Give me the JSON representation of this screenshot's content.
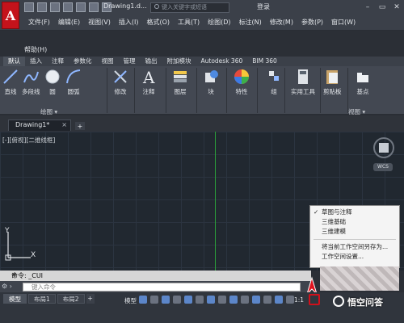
{
  "titlebar": {
    "doc_title": "Drawing1.d...",
    "search_placeholder": "键入关键字或短语",
    "login_label": "登录"
  },
  "menu": {
    "items": [
      "文件(F)",
      "编辑(E)",
      "视图(V)",
      "插入(I)",
      "格式(O)",
      "工具(T)",
      "绘图(D)",
      "标注(N)",
      "修改(M)",
      "参数(P)",
      "窗口(W)"
    ],
    "help": "帮助(H)"
  },
  "ribbon_tabs": [
    "默认",
    "插入",
    "注释",
    "参数化",
    "视图",
    "管理",
    "输出",
    "附加模块",
    "Autodesk 360",
    "BIM 360"
  ],
  "ribbon": {
    "tools": [
      "直线",
      "多段线",
      "圆",
      "圆弧",
      "修改",
      "注释",
      "图层",
      "块",
      "特性",
      "组",
      "实用工具",
      "剪贴板",
      "基点"
    ],
    "panel_draw": "绘图 ▾",
    "panel_view": "视图 ▾"
  },
  "doc_tab": {
    "label": "Drawing1*",
    "close": "×",
    "add": "+"
  },
  "canvas": {
    "viewport_label": "[-][俯视][二维线框]",
    "wcs": "WCS",
    "ucs_y": "Y",
    "ucs_x": "X"
  },
  "context_menu": {
    "items": [
      {
        "label": "草图与注释",
        "checked": true
      },
      {
        "label": "三维基础",
        "checked": false
      },
      {
        "label": "三维建模",
        "checked": false
      }
    ],
    "actions": [
      "将当前工作空间另存为...",
      "工作空间设置..."
    ],
    "check_glyph": "✓"
  },
  "command": {
    "history": "命令: _CUI",
    "input_placeholder": "键入命令",
    "close_glyph": "✕"
  },
  "status": {
    "layout_tabs": [
      "模型",
      "布局1",
      "布局2"
    ],
    "add": "+",
    "model_button": "模型",
    "scale": "1:1"
  },
  "watermark": "悟空问答",
  "colors": {
    "accent_red": "#c4131b",
    "ortho_green": "#2ba03a"
  }
}
